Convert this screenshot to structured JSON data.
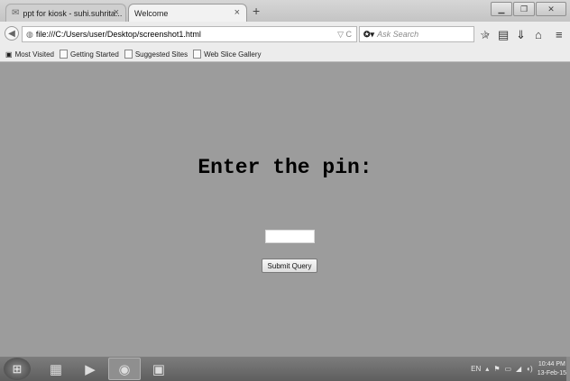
{
  "tabs": [
    {
      "title": "ppt for kiosk - suhi.suhrita...",
      "icon": "gmail-icon",
      "active": false
    },
    {
      "title": "Welcome",
      "active": true
    }
  ],
  "new_tab": "+",
  "address": {
    "url": "file:///C:/Users/user/Desktop/screenshot1.html",
    "reload": "▽ C"
  },
  "search": {
    "engine": "✪▾",
    "placeholder": "Ask Search",
    "icon": "⌕"
  },
  "toolbar_icons": [
    "star-icon",
    "bookmark-list-icon",
    "download-icon",
    "home-icon",
    "menu-icon"
  ],
  "bookmarks": [
    {
      "label": "Most Visited",
      "icon": "most-visited-icon"
    },
    {
      "label": "Getting Started"
    },
    {
      "label": "Suggested Sites"
    },
    {
      "label": "Web Slice Gallery"
    }
  ],
  "page": {
    "heading": "Enter the pin:",
    "pin_value": "",
    "submit_label": "Submit Query"
  },
  "taskbar": {
    "apps": [
      "windows-start-icon",
      "file-explorer-icon",
      "media-player-icon",
      "firefox-icon",
      "remote-desktop-icon"
    ],
    "tray": {
      "lang": "EN",
      "time": "10:44 PM",
      "date": "13-Feb-15"
    }
  }
}
